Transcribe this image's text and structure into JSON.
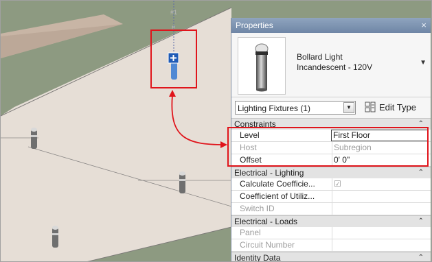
{
  "viewport": {
    "level_marks": [
      "#1",
      "#"
    ]
  },
  "properties": {
    "title": "Properties",
    "close_glyph": "×",
    "type_name_line1": "Bollard Light",
    "type_name_line2": "Incandescent - 120V",
    "type_dropdown_glyph": "▼",
    "filter_value": "Lighting Fixtures (1)",
    "filter_arrow_glyph": "▼",
    "edit_type_label": "Edit Type",
    "groups": [
      {
        "label": "Constraints",
        "chevron": "⌃",
        "rows": [
          {
            "label": "Level",
            "value": "First Floor"
          },
          {
            "label": "Host",
            "value": "Subregion"
          },
          {
            "label": "Offset",
            "value": "0'  0\""
          }
        ]
      },
      {
        "label": "Electrical - Lighting",
        "chevron": "⌃",
        "rows": [
          {
            "label": "Calculate Coefficie...",
            "value": "☑"
          },
          {
            "label": "Coefficient of Utiliz...",
            "value": ""
          },
          {
            "label": "Switch ID",
            "value": ""
          }
        ]
      },
      {
        "label": "Electrical - Loads",
        "chevron": "⌃",
        "rows": [
          {
            "label": "Panel",
            "value": ""
          },
          {
            "label": "Circuit Number",
            "value": ""
          }
        ]
      },
      {
        "label": "Identity Data",
        "chevron": "⌃",
        "rows": []
      }
    ]
  },
  "colors": {
    "ground": "#8d9a81",
    "road": "#c8b5a5",
    "path": "#e6ded6",
    "callout": "#e0141b",
    "selected": "#3f7fd4"
  }
}
